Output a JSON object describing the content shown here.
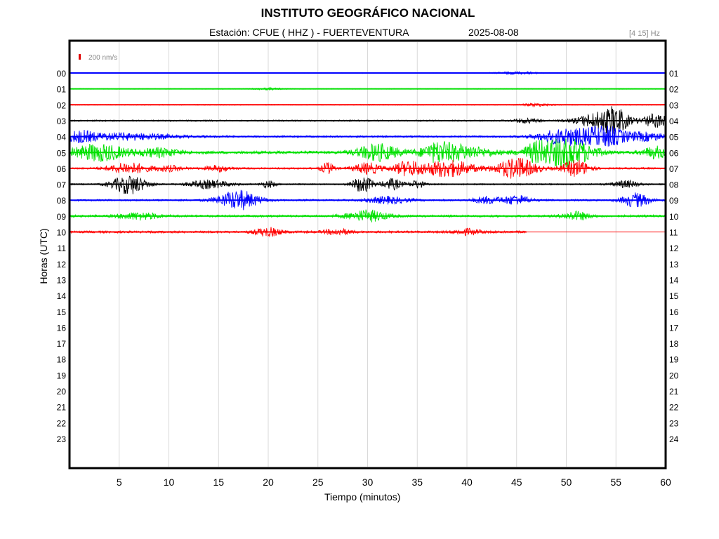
{
  "header": {
    "title": "INSTITUTO GEOGRÁFICO NACIONAL",
    "station_line": "Estación:  CFUE ( HHZ ) - FUERTEVENTURA",
    "date": "2025-08-08",
    "filter": "[4 15] Hz"
  },
  "chart_data": {
    "type": "line",
    "title": "INSTITUTO GEOGRÁFICO NACIONAL",
    "xlabel": "Tiempo (minutos)",
    "ylabel": "Horas (UTC)",
    "xlim": [
      0,
      60
    ],
    "x_ticks": [
      5,
      10,
      15,
      20,
      25,
      30,
      35,
      40,
      45,
      50,
      55,
      60
    ],
    "left_hour_labels": [
      "00",
      "01",
      "02",
      "03",
      "04",
      "05",
      "06",
      "07",
      "08",
      "09",
      "10",
      "11",
      "12",
      "13",
      "14",
      "15",
      "16",
      "17",
      "18",
      "19",
      "20",
      "21",
      "22",
      "23"
    ],
    "right_hour_labels": [
      "01",
      "02",
      "03",
      "04",
      "05",
      "06",
      "07",
      "08",
      "09",
      "10",
      "11",
      "12",
      "13",
      "14",
      "15",
      "16",
      "17",
      "18",
      "19",
      "20",
      "21",
      "22",
      "23",
      "24"
    ],
    "grid": "vertical",
    "scale_bar": "200 nm/s",
    "colors": {
      "blue": "#0000ff",
      "green": "#00e000",
      "red": "#ff0000",
      "black": "#000000",
      "grid": "#d9d9d9",
      "scale": "#e00000"
    },
    "series": [
      {
        "hour": "00",
        "color": "blue",
        "end_min": 60,
        "noise": 0.6,
        "events": [
          {
            "t": 45,
            "amp": 1.5,
            "dur": 3
          }
        ]
      },
      {
        "hour": "01",
        "color": "green",
        "end_min": 60,
        "noise": 0.6,
        "events": [
          {
            "t": 20,
            "amp": 1.2,
            "dur": 2
          }
        ]
      },
      {
        "hour": "02",
        "color": "red",
        "end_min": 60,
        "noise": 0.6,
        "events": [
          {
            "t": 47,
            "amp": 2,
            "dur": 2
          }
        ]
      },
      {
        "hour": "03",
        "color": "black",
        "end_min": 60,
        "noise": 1.0,
        "events": [
          {
            "t": 46,
            "amp": 3,
            "dur": 2
          },
          {
            "t": 53,
            "amp": 10,
            "dur": 3
          },
          {
            "t": 55,
            "amp": 16,
            "dur": 2
          },
          {
            "t": 59,
            "amp": 10,
            "dur": 2
          }
        ]
      },
      {
        "hour": "04",
        "color": "blue",
        "end_min": 60,
        "noise": 1.2,
        "events": [
          {
            "t": 1,
            "amp": 6,
            "dur": 2
          },
          {
            "t": 5,
            "amp": 5,
            "dur": 8
          },
          {
            "t": 50,
            "amp": 12,
            "dur": 4
          },
          {
            "t": 54,
            "amp": 14,
            "dur": 3
          },
          {
            "t": 58,
            "amp": 6,
            "dur": 3
          }
        ]
      },
      {
        "hour": "05",
        "color": "green",
        "end_min": 60,
        "noise": 2.0,
        "events": [
          {
            "t": 3,
            "amp": 12,
            "dur": 4
          },
          {
            "t": 9,
            "amp": 6,
            "dur": 3
          },
          {
            "t": 31,
            "amp": 12,
            "dur": 3
          },
          {
            "t": 37,
            "amp": 8,
            "dur": 2
          },
          {
            "t": 39,
            "amp": 10,
            "dur": 5
          },
          {
            "t": 47,
            "amp": 10,
            "dur": 2
          },
          {
            "t": 50,
            "amp": 20,
            "dur": 4
          },
          {
            "t": 59,
            "amp": 8,
            "dur": 2
          }
        ]
      },
      {
        "hour": "06",
        "color": "red",
        "end_min": 60,
        "noise": 1.2,
        "events": [
          {
            "t": 6,
            "amp": 8,
            "dur": 3
          },
          {
            "t": 10,
            "amp": 4,
            "dur": 2
          },
          {
            "t": 15,
            "amp": 4,
            "dur": 2
          },
          {
            "t": 26,
            "amp": 8,
            "dur": 1
          },
          {
            "t": 30,
            "amp": 8,
            "dur": 2
          },
          {
            "t": 34,
            "amp": 10,
            "dur": 2
          },
          {
            "t": 38,
            "amp": 12,
            "dur": 4
          },
          {
            "t": 45,
            "amp": 15,
            "dur": 3
          },
          {
            "t": 51,
            "amp": 12,
            "dur": 2
          }
        ]
      },
      {
        "hour": "07",
        "color": "black",
        "end_min": 60,
        "noise": 1.0,
        "events": [
          {
            "t": 6,
            "amp": 14,
            "dur": 2.5
          },
          {
            "t": 14,
            "amp": 6,
            "dur": 3
          },
          {
            "t": 20,
            "amp": 5,
            "dur": 1
          },
          {
            "t": 29.5,
            "amp": 12,
            "dur": 1.5
          },
          {
            "t": 32.5,
            "amp": 8,
            "dur": 1.5
          },
          {
            "t": 35,
            "amp": 6,
            "dur": 1
          },
          {
            "t": 56,
            "amp": 5,
            "dur": 2
          }
        ]
      },
      {
        "hour": "08",
        "color": "blue",
        "end_min": 60,
        "noise": 1.2,
        "events": [
          {
            "t": 17,
            "amp": 14,
            "dur": 3
          },
          {
            "t": 32,
            "amp": 5,
            "dur": 3
          },
          {
            "t": 42,
            "amp": 5,
            "dur": 2
          },
          {
            "t": 45,
            "amp": 7,
            "dur": 2
          },
          {
            "t": 57,
            "amp": 10,
            "dur": 2
          }
        ]
      },
      {
        "hour": "09",
        "color": "green",
        "end_min": 60,
        "noise": 1.5,
        "events": [
          {
            "t": 7,
            "amp": 5,
            "dur": 3
          },
          {
            "t": 30,
            "amp": 8,
            "dur": 3
          },
          {
            "t": 51,
            "amp": 6,
            "dur": 2
          }
        ]
      },
      {
        "hour": "10",
        "color": "red",
        "end_min": 46,
        "noise": 1.5,
        "events": [
          {
            "t": 20,
            "amp": 6,
            "dur": 2
          },
          {
            "t": 27,
            "amp": 4,
            "dur": 2
          },
          {
            "t": 40,
            "amp": 4,
            "dur": 2
          }
        ]
      }
    ]
  }
}
